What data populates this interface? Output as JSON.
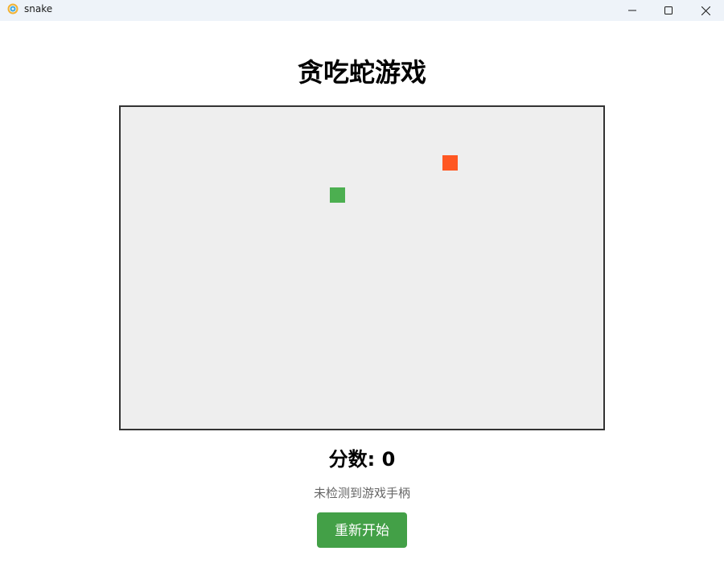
{
  "window": {
    "title": "snake"
  },
  "page": {
    "title": "贪吃蛇游戏"
  },
  "game": {
    "grid": {
      "cols": 30,
      "rows": 20
    },
    "snake": [
      {
        "col": 13,
        "row": 5
      }
    ],
    "food": {
      "col": 20,
      "row": 3
    },
    "colors": {
      "snake": "#4caf50",
      "food": "#ff5722",
      "board": "#eeeeee",
      "border": "#333333"
    }
  },
  "score": {
    "text": "分数: 0"
  },
  "gamepad": {
    "status": "未检测到游戏手柄"
  },
  "controls": {
    "restart_label": "重新开始",
    "restart_color": "#43a047"
  }
}
